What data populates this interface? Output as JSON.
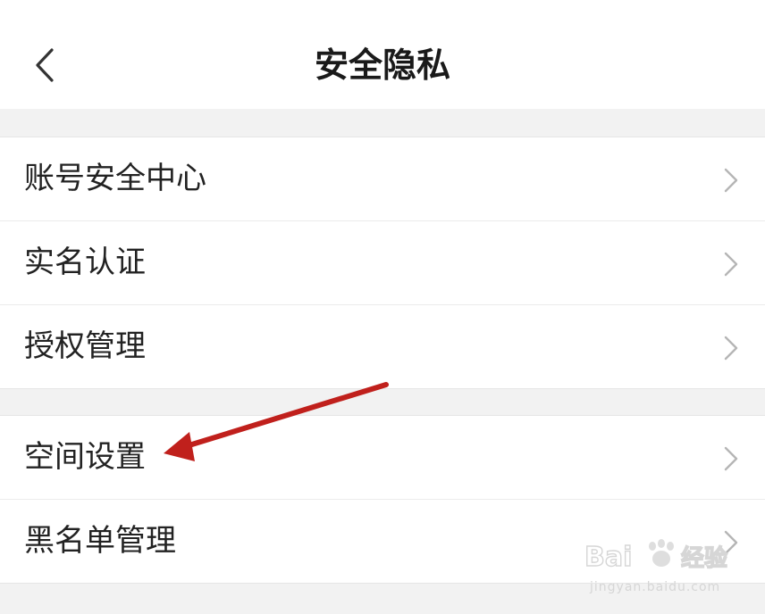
{
  "header": {
    "title": "安全隐私",
    "back_icon": "chevron-left-icon"
  },
  "groups": [
    {
      "items": [
        {
          "label": "账号安全中心",
          "icon": "chevron-right-icon"
        },
        {
          "label": "实名认证",
          "icon": "chevron-right-icon"
        },
        {
          "label": "授权管理",
          "icon": "chevron-right-icon"
        }
      ]
    },
    {
      "items": [
        {
          "label": "空间设置",
          "icon": "chevron-right-icon"
        },
        {
          "label": "黑名单管理",
          "icon": "chevron-right-icon"
        }
      ]
    }
  ],
  "annotation": {
    "type": "arrow",
    "color": "#c0201c",
    "points_to": "空间设置"
  },
  "watermark": {
    "logo_text": "Baidu经验",
    "url_text": "jingyan.baidu.com"
  },
  "colors": {
    "page_background": "#f2f2f2",
    "row_background": "#ffffff",
    "chevron": "#b5b5b5"
  }
}
